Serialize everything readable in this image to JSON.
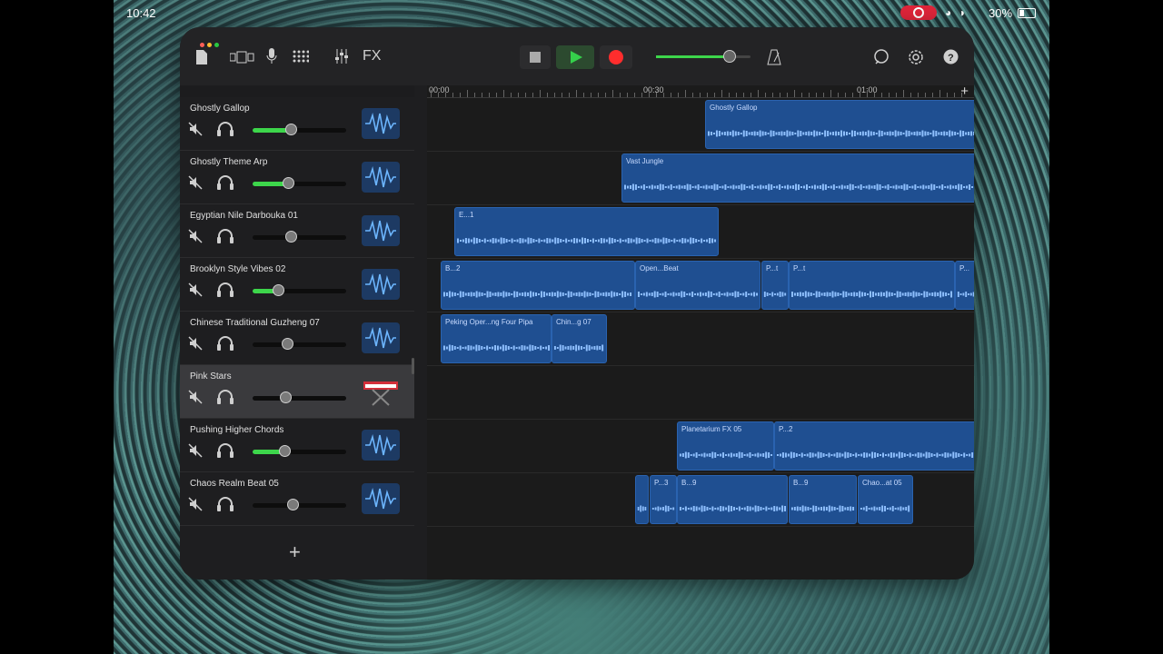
{
  "status_bar": {
    "time": "10:42",
    "battery": "30%"
  },
  "toolbar": {
    "fx_label": "FX",
    "buttons": [
      "document-icon",
      "view-toggle-icon",
      "microphone-icon",
      "grid-icon",
      "mixer-icon",
      "stop-icon",
      "play-icon",
      "record-icon",
      "master-volume",
      "metronome-icon",
      "loop-icon",
      "settings-icon",
      "help-icon"
    ],
    "master_volume_level": 0.78
  },
  "ruler": {
    "labels": [
      "00:00",
      "00:30",
      "01:00"
    ]
  },
  "tracks": [
    {
      "name": "Ghostly Gallop",
      "volume": 0.41,
      "icon": "waveform-icon"
    },
    {
      "name": "Ghostly Theme Arp",
      "volume": 0.38,
      "icon": "waveform-icon"
    },
    {
      "name": "Egyptian Nile Darbouka 01",
      "volume": 0.41,
      "icon": "waveform-icon"
    },
    {
      "name": "Brooklyn Style Vibes 02",
      "volume": 0.27,
      "icon": "waveform-icon"
    },
    {
      "name": "Chinese Traditional Guzheng 07",
      "volume": 0.37,
      "icon": "waveform-icon"
    },
    {
      "name": "Pink Stars",
      "volume": 0.35,
      "icon": "keyboard-icon",
      "selected": true
    },
    {
      "name": "Pushing Higher Chords",
      "volume": 0.34,
      "icon": "waveform-icon"
    },
    {
      "name": "Chaos Realm Beat 05",
      "volume": 0.43,
      "icon": "waveform-icon"
    }
  ],
  "regions": [
    {
      "lane": 0,
      "label": "Ghostly Gallop"
    },
    {
      "lane": 1,
      "label": "Vast Jungle"
    },
    {
      "lane": 2,
      "label": "E...1"
    },
    {
      "lane": 3,
      "label": "B...2"
    },
    {
      "lane": 3,
      "label": "Open...Beat"
    },
    {
      "lane": 3,
      "label": "P...t"
    },
    {
      "lane": 3,
      "label": "P...t"
    },
    {
      "lane": 3,
      "label": "P..."
    },
    {
      "lane": 4,
      "label": "Peking Oper...ng Four Pipa"
    },
    {
      "lane": 4,
      "label": "Chin...g 07"
    },
    {
      "lane": 6,
      "label": "Planetarium FX 05"
    },
    {
      "lane": 6,
      "label": "P...2"
    },
    {
      "lane": 7,
      "label": ""
    },
    {
      "lane": 7,
      "label": "P...3"
    },
    {
      "lane": 7,
      "label": "B...9"
    },
    {
      "lane": 7,
      "label": "B...9"
    },
    {
      "lane": 7,
      "label": "Chao...at 05"
    }
  ]
}
